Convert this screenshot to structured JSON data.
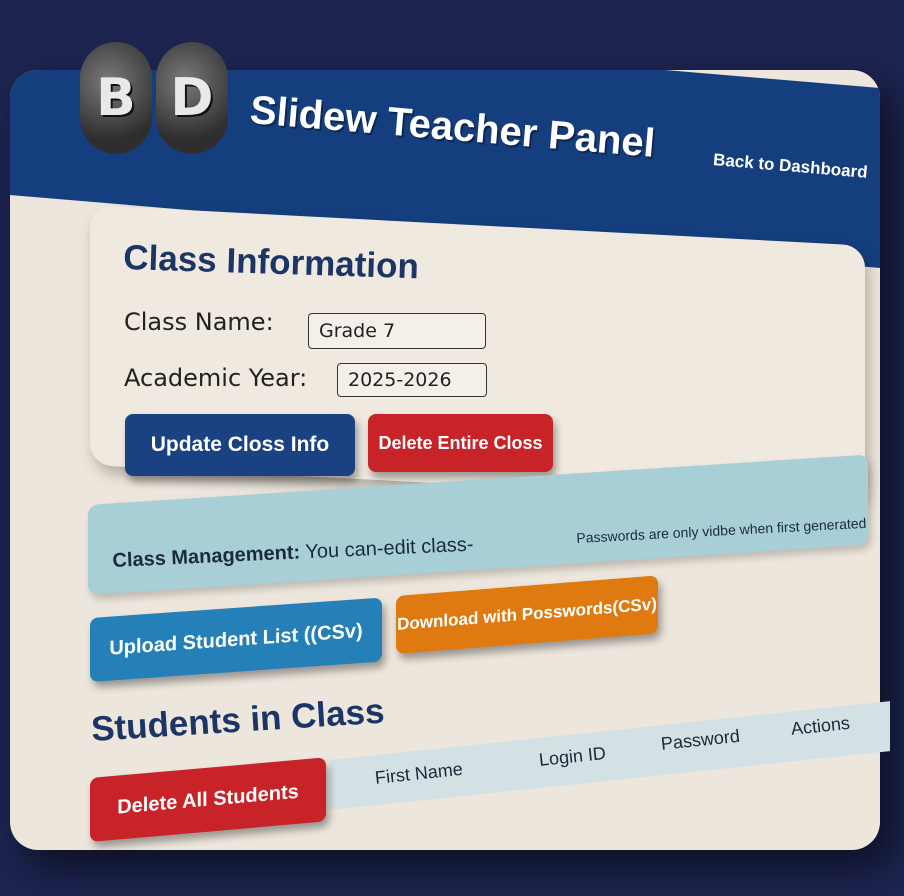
{
  "header": {
    "logo_letters": [
      "B",
      "D"
    ],
    "title": "Slidew Teacher Panel",
    "back_link": "Back to Dashboard"
  },
  "class_info": {
    "title": "Class Information",
    "class_name_label": "Class Name:",
    "class_name_value": "Grade 7",
    "academic_year_label": "Academic Year:",
    "academic_year_value": "2025-2026",
    "update_button": "Update Closs Info",
    "delete_button": "Delete Entire Closs"
  },
  "banner": {
    "bold_text": "Class Management:",
    "text": "You can-edit class-",
    "note": "Passwords are only vidbe when first generated"
  },
  "actions": {
    "upload_button": "Upload Student List ((CSv)",
    "download_button": "Download with Posswords(CSv)"
  },
  "students": {
    "title": "Students in Class",
    "delete_all_button": "Delete All Students",
    "columns": [
      "First Name",
      "Login ID",
      "Password",
      "Actions"
    ]
  },
  "colors": {
    "header_bg": "#153e7e",
    "primary": "#1a4282",
    "danger": "#c9232a",
    "info": "#2680b8",
    "warning": "#df7a10",
    "banner_bg": "#a9cfd6"
  }
}
